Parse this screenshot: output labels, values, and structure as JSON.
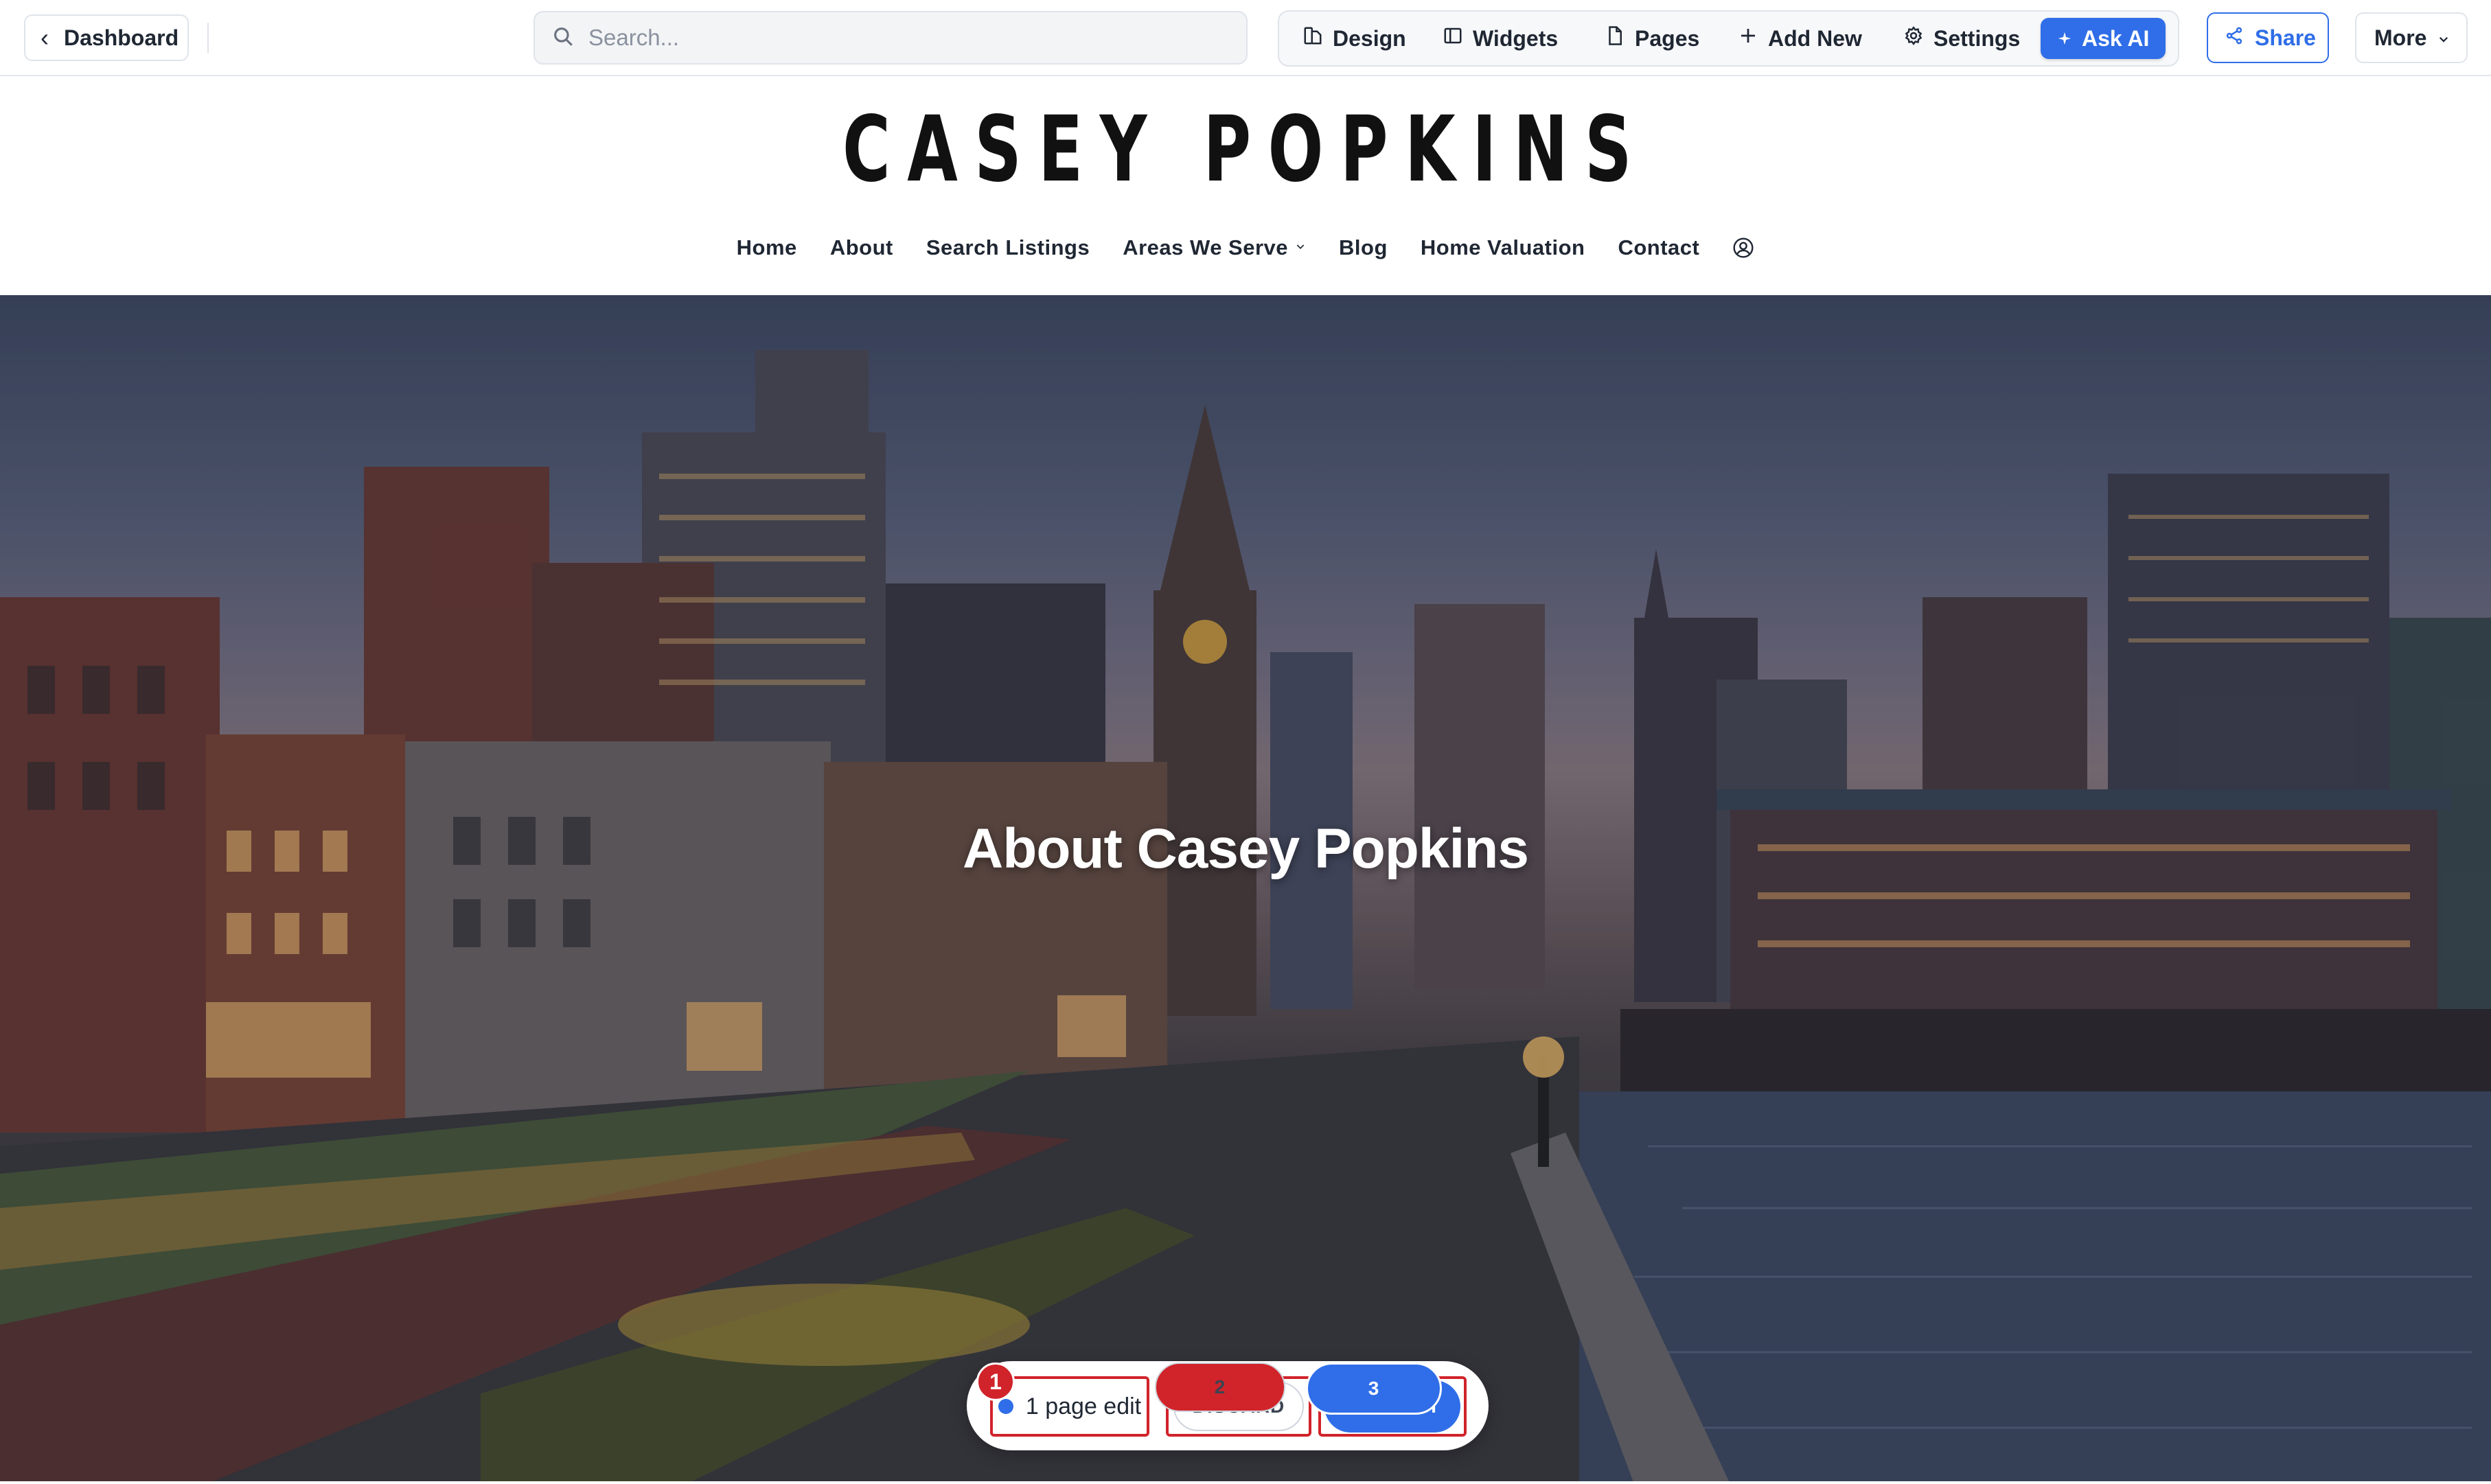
{
  "toolbar": {
    "dashboard_label": "Dashboard",
    "search_placeholder": "Search...",
    "tools": [
      {
        "label": "Design",
        "icon": "design-icon"
      },
      {
        "label": "Widgets",
        "icon": "widgets-icon"
      },
      {
        "label": "Pages",
        "icon": "pages-icon"
      },
      {
        "label": "Add New",
        "icon": "plus-icon"
      },
      {
        "label": "Settings",
        "icon": "gear-icon"
      },
      {
        "label": "Ask AI",
        "icon": "sparkle-icon"
      }
    ],
    "share_label": "Share",
    "more_label": "More"
  },
  "site": {
    "brand": "CASEY POPKINS",
    "nav": [
      "Home",
      "About",
      "Search Listings",
      "Areas We Serve",
      "Blog",
      "Home Valuation",
      "Contact"
    ]
  },
  "hero": {
    "title": "About Casey Popkins"
  },
  "publish_bar": {
    "edits_label": "1 page edit",
    "discard_label": "DISCARD",
    "publish_label": "PUBLISH",
    "badges": [
      "1",
      "2",
      "3"
    ]
  },
  "colors": {
    "accent": "#2f6ee8",
    "annotation": "#d1232a"
  }
}
